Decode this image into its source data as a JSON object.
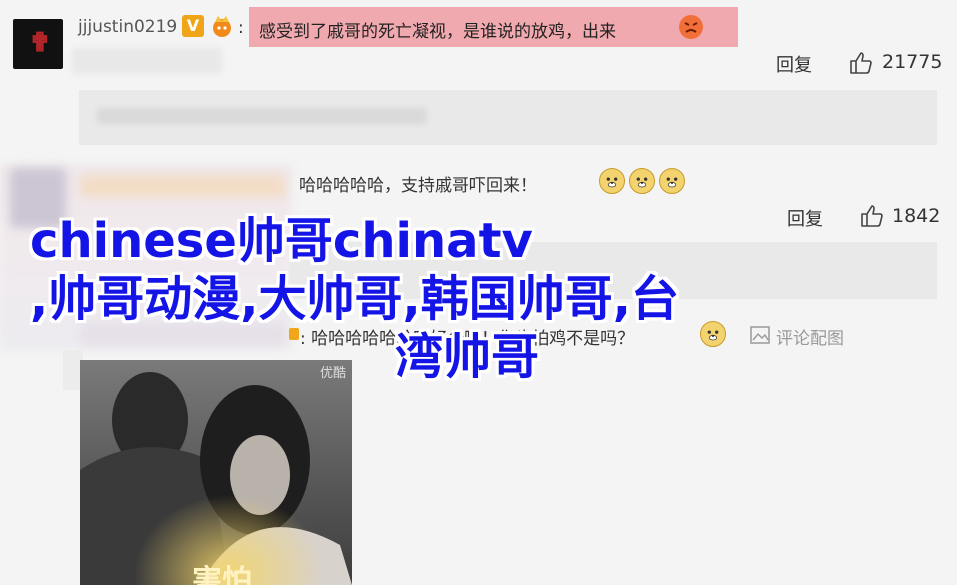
{
  "comment1": {
    "username": "jjjustin0219",
    "verified_badge": "V",
    "separator": ":",
    "text": "感受到了戚哥的死亡凝视，是谁说的放鸡，出来",
    "reply_label": "回复",
    "likes": "21775",
    "highlight_color": "#f1a9b0"
  },
  "comment2": {
    "text": "哈哈哈哈哈，支持戚哥吓回来！",
    "reply_label": "回复",
    "likes": "1842"
  },
  "comment3": {
    "separator": ":",
    "text": "哈哈哈哈哈哈哈好公啊！你也怕鸡不是吗？",
    "comment_image_label": "评论配图"
  },
  "photo": {
    "overlay_text": "害怕",
    "watermark": "优酷"
  },
  "overlay_title": {
    "line1": "chinese帅哥chinatv",
    "line2": ",帅哥动漫,大帅哥,韩国帅哥,台",
    "line3": "湾帅哥",
    "color": "#1414e6"
  },
  "icons": {
    "like": "thumbs-up-icon",
    "emoji": "dog-emoji-icon",
    "image": "image-icon",
    "member": "vip-crown-icon"
  }
}
